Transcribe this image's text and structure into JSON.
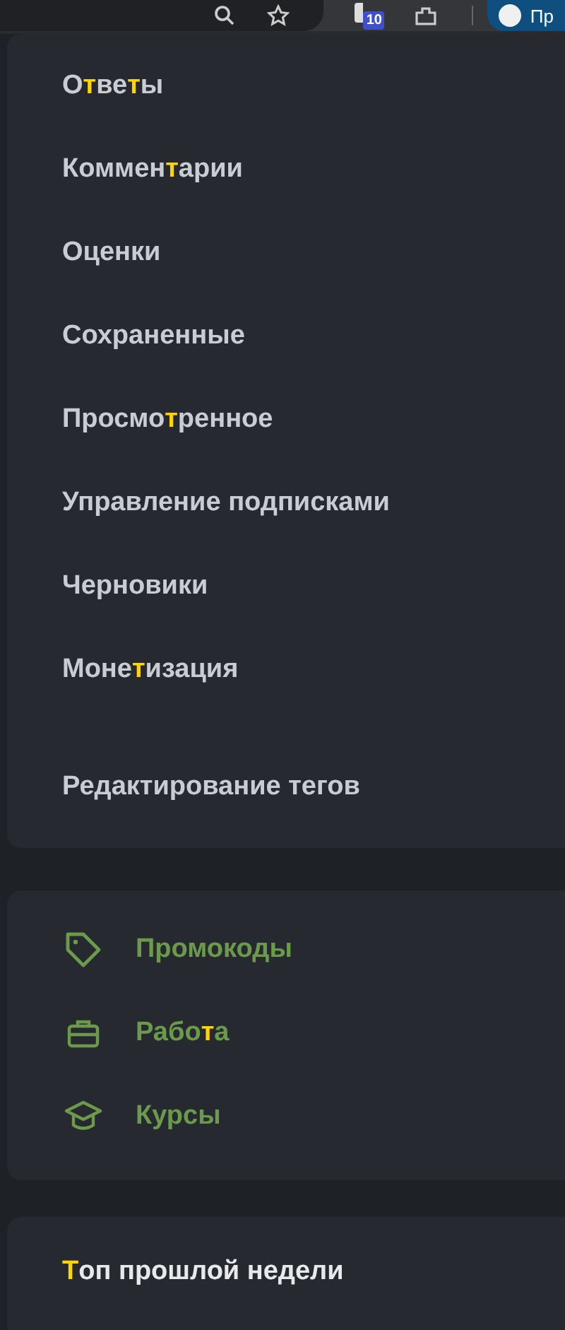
{
  "browser_toolbar": {
    "extension_badge": "10",
    "profile_label": "Пр"
  },
  "menu": {
    "items": [
      {
        "label": "О**т**ве**т**ы"
      },
      {
        "label": "Коммен**т**арии"
      },
      {
        "label": "Оценки"
      },
      {
        "label": "Сохраненные"
      },
      {
        "label": "Просмо**т**ренное"
      },
      {
        "label": "Управление подписками"
      },
      {
        "label": "Черновики"
      },
      {
        "label": "Моне**т**изация"
      }
    ],
    "footer_item": {
      "label": "Редактирование тегов"
    }
  },
  "services": {
    "items": [
      {
        "kind": "tag",
        "label": "Промокоды"
      },
      {
        "kind": "briefcase",
        "label": "Рабо**т**а"
      },
      {
        "kind": "cap",
        "label": "Курсы"
      }
    ]
  },
  "top_section": {
    "title": "**Т**оп прошлой недели"
  }
}
